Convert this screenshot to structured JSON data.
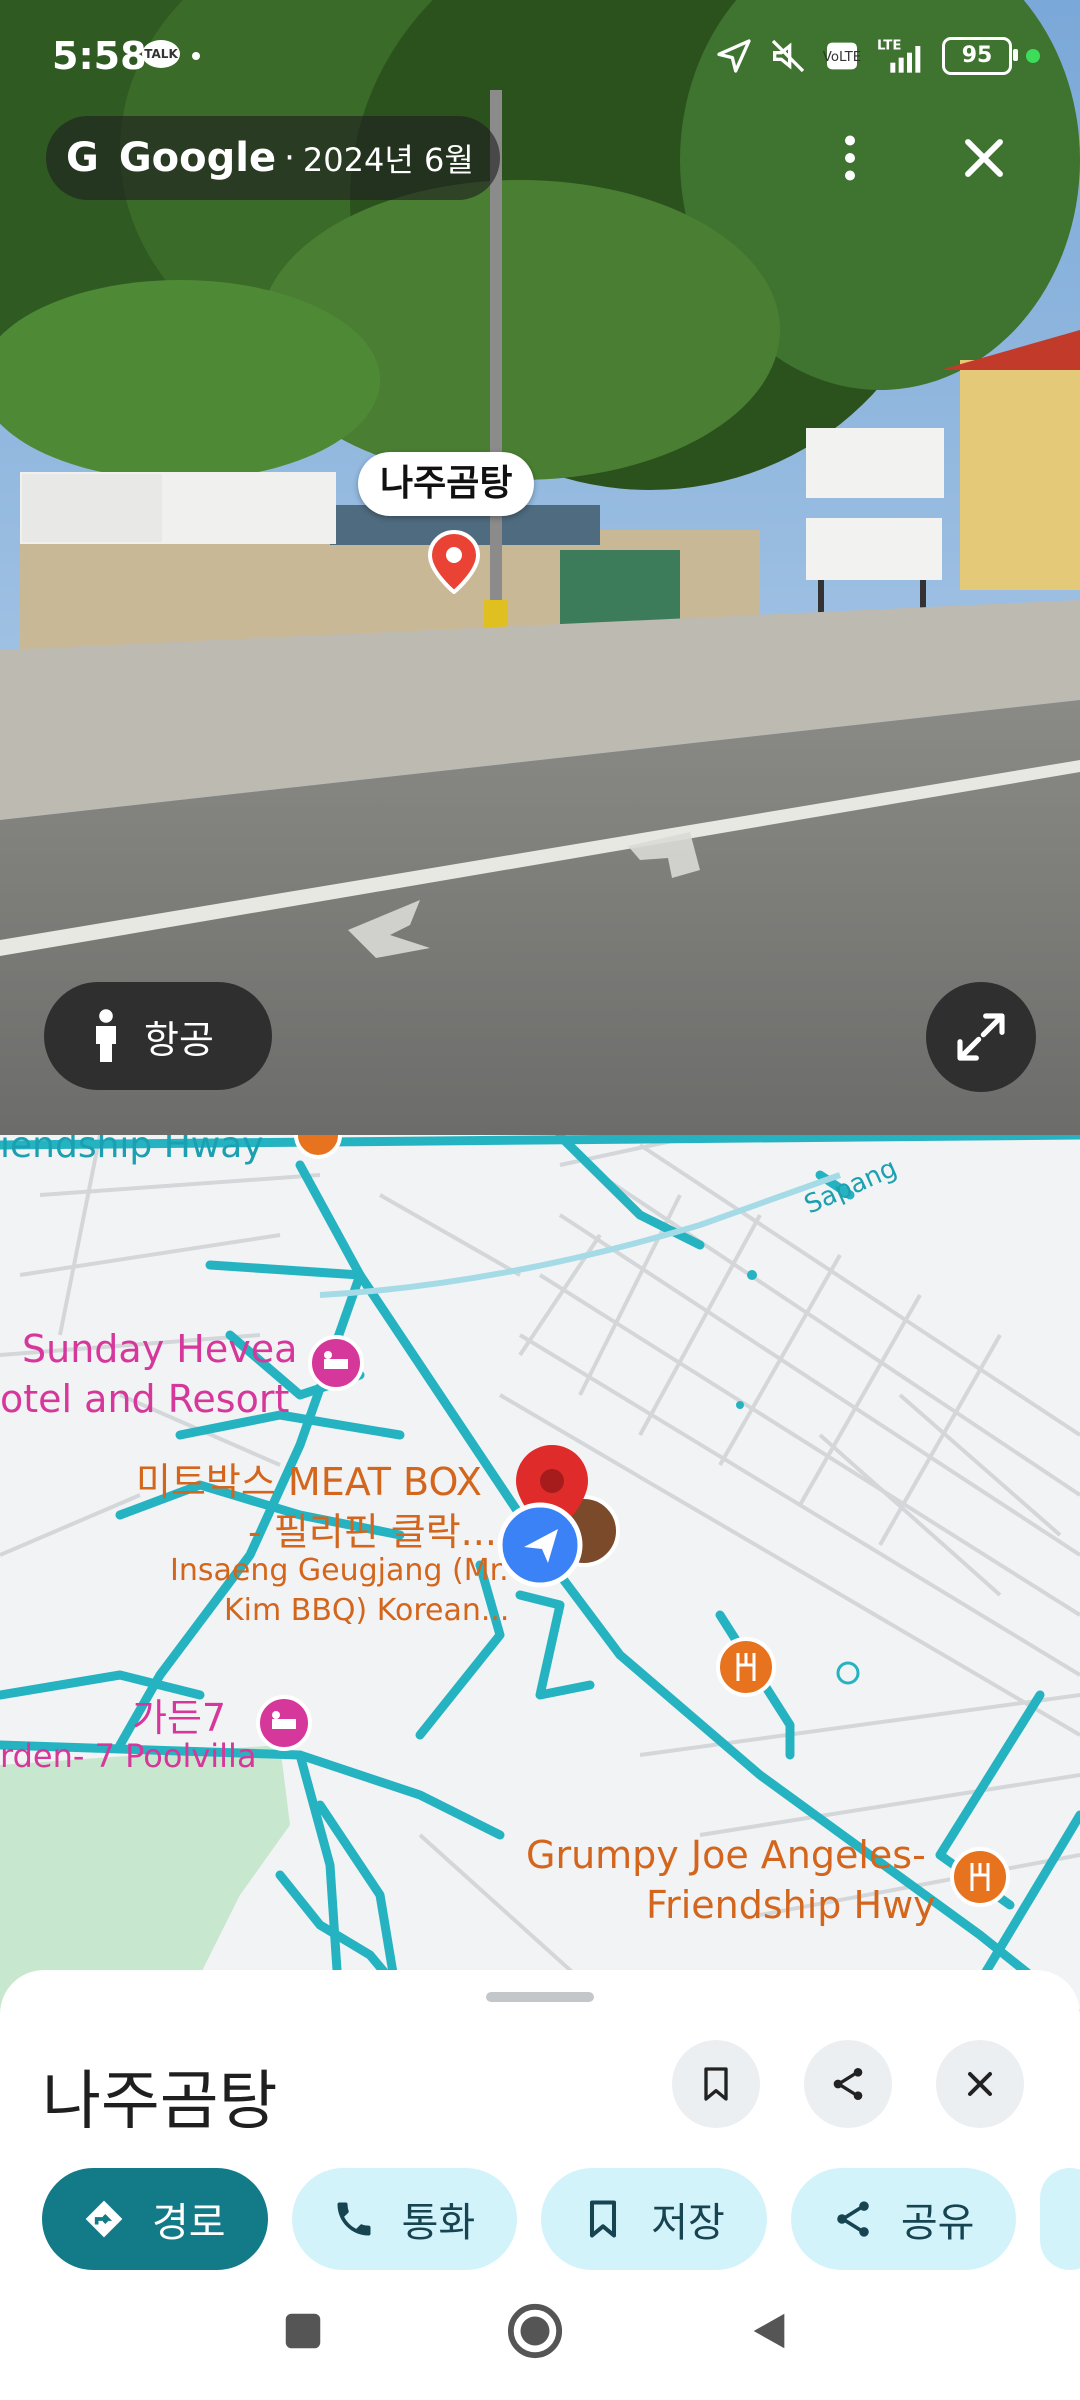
{
  "status_bar": {
    "time": "5:58",
    "talk_badge": "TALK",
    "network": "LTE",
    "battery": "95",
    "icons": [
      "navigation-icon",
      "mute-icon",
      "volte-icon",
      "signal-icon",
      "battery-icon"
    ]
  },
  "street_view": {
    "brand": "Google",
    "separator": "·",
    "capture_date": "2024년 6월",
    "place_label": "나주곰탕",
    "aerial_button": "항공",
    "icons": [
      "google-g-icon",
      "more-vert-icon",
      "close-icon",
      "place-pin-icon",
      "person-icon",
      "expand-icon"
    ]
  },
  "map": {
    "labels": {
      "road_top": "iendship Hway",
      "road_sapang": "Sapang",
      "hotel_line1": "Sunday Hevea",
      "hotel_line2": "otel and Resort",
      "meatbox_line1": "미트박스 MEAT BOX",
      "meatbox_line2": "- 필리핀 클락...",
      "insaeng_line1": "Insaeng Geugjang (Mr.",
      "insaeng_line2": "Kim BBQ) Korean...",
      "garden_line1": "가든7",
      "garden_line2": "rden- 7 Poolvilla",
      "grumpy_line1": "Grumpy Joe Angeles-",
      "grumpy_line2": "Friendship Hwy"
    },
    "colors": {
      "road": "#25b3c2",
      "hotel": "#d6379b",
      "restaurant": "#e8731f",
      "pin": "#e02b2b",
      "you": "#3b82f6",
      "park": "#c8e7cf"
    },
    "icons": [
      "hotel-icon",
      "restaurant-icon",
      "location-pin-icon",
      "my-location-icon"
    ]
  },
  "sheet": {
    "title": "나주곰탕",
    "chips": [
      {
        "label": "경로",
        "icon": "directions-icon"
      },
      {
        "label": "통화",
        "icon": "phone-icon"
      },
      {
        "label": "저장",
        "icon": "bookmark-icon"
      },
      {
        "label": "공유",
        "icon": "share-icon"
      }
    ],
    "header_icons": [
      "bookmark-icon",
      "share-icon",
      "close-icon"
    ]
  },
  "nav_bar": {
    "buttons": [
      "recents-button",
      "home-button",
      "back-button"
    ]
  }
}
